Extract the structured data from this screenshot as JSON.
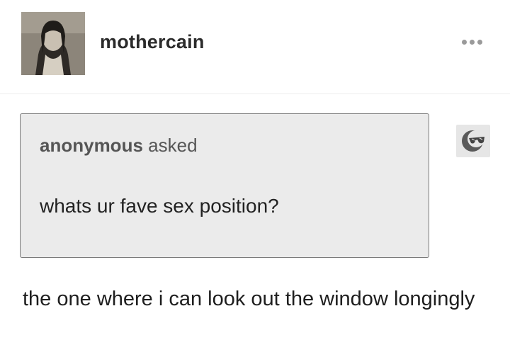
{
  "post": {
    "username": "mothercain",
    "more_icon": "ellipsis-icon"
  },
  "ask": {
    "asker": "anonymous",
    "asked_label": "asked",
    "question": "whats ur fave sex position?",
    "anon_icon": "anonymous-sunglasses-icon"
  },
  "answer": {
    "text": "the one where i can look out the window longingly"
  }
}
